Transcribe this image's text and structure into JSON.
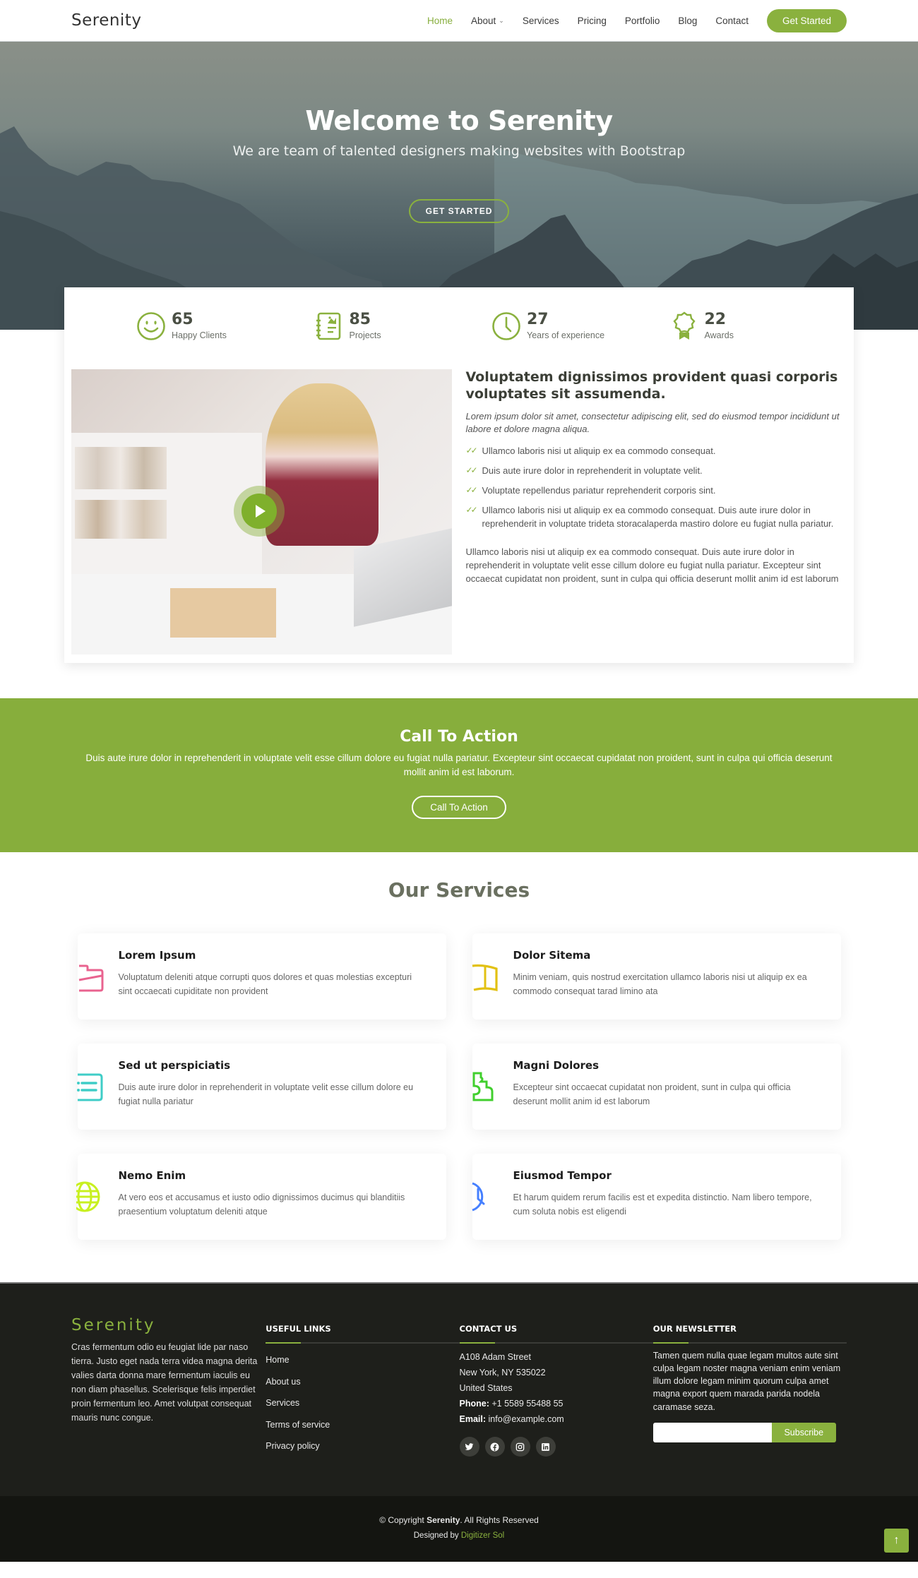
{
  "header": {
    "logo": "Serenity",
    "nav": [
      {
        "label": "Home",
        "active": true
      },
      {
        "label": "About",
        "dropdown": true
      },
      {
        "label": "Services"
      },
      {
        "label": "Pricing"
      },
      {
        "label": "Portfolio"
      },
      {
        "label": "Blog"
      },
      {
        "label": "Contact"
      }
    ],
    "cta_label": "Get Started"
  },
  "hero": {
    "title": "Welcome to Serenity",
    "subtitle": "We are team of talented designers making websites with Bootstrap",
    "button_label": "GET STARTED"
  },
  "stats": [
    {
      "icon": "smiley-icon",
      "value": "65",
      "label": "Happy Clients"
    },
    {
      "icon": "journal-richtext-icon",
      "value": "85",
      "label": "Projects"
    },
    {
      "icon": "clock-icon",
      "value": "27",
      "label": "Years of experience"
    },
    {
      "icon": "award-icon",
      "value": "22",
      "label": "Awards"
    }
  ],
  "about": {
    "title": "Voluptatem dignissimos provident quasi corporis voluptates sit assumenda.",
    "lead": "Lorem ipsum dolor sit amet, consectetur adipiscing elit, sed do eiusmod tempor incididunt ut labore et dolore magna aliqua.",
    "checklist": [
      "Ullamco laboris nisi ut aliquip ex ea commodo consequat.",
      "Duis aute irure dolor in reprehenderit in voluptate velit.",
      "Voluptate repellendus pariatur reprehenderit corporis sint.",
      "Ullamco laboris nisi ut aliquip ex ea commodo consequat. Duis aute irure dolor in reprehenderit in voluptate trideta storacalaperda mastiro dolore eu fugiat nulla pariatur."
    ],
    "body": "Ullamco laboris nisi ut aliquip ex ea commodo consequat. Duis aute irure dolor in reprehenderit in voluptate velit esse cillum dolore eu fugiat nulla pariatur. Excepteur sint occaecat cupidatat non proident, sunt in culpa qui officia deserunt mollit anim id est laborum"
  },
  "cta": {
    "title": "Call To Action",
    "text": "Duis aute irure dolor in reprehenderit in voluptate velit esse cillum dolore eu fugiat nulla pariatur. Excepteur sint occaecat cupidatat non proident, sunt in culpa qui officia deserunt mollit anim id est laborum.",
    "button_label": "Call To Action"
  },
  "services": {
    "title": "Our Services",
    "items": [
      {
        "icon": "briefcase-icon",
        "color": "#e9638f",
        "title": "Lorem Ipsum",
        "text": "Voluptatum deleniti atque corrupti quos dolores et quas molestias excepturi sint occaecati cupiditate non provident"
      },
      {
        "icon": "book-icon",
        "color": "#e2c113",
        "title": "Dolor Sitema",
        "text": "Minim veniam, quis nostrud exercitation ullamco laboris nisi ut aliquip ex ea commodo consequat tarad limino ata"
      },
      {
        "icon": "card-list-icon",
        "color": "#3fcdc7",
        "title": "Sed ut perspiciatis",
        "text": "Duis aute irure dolor in reprehenderit in voluptate velit esse cillum dolore eu fugiat nulla pariatur"
      },
      {
        "icon": "puzzle-icon",
        "color": "#41cf2e",
        "title": "Magni Dolores",
        "text": "Excepteur sint occaecat cupidatat non proident, sunt in culpa qui officia deserunt mollit anim id est laborum"
      },
      {
        "icon": "globe-icon",
        "color": "#d6ff22",
        "title": "Nemo Enim",
        "text": "At vero eos et accusamus et iusto odio dignissimos ducimus qui blanditiis praesentium voluptatum deleniti atque"
      },
      {
        "icon": "clock-icon",
        "color": "#4680ff",
        "title": "Eiusmod Tempor",
        "text": "Et harum quidem rerum facilis est et expedita distinctio. Nam libero tempore, cum soluta nobis est eligendi"
      }
    ]
  },
  "footer": {
    "brand": "Serenity",
    "about": "Cras fermentum odio eu feugiat lide par naso tierra. Justo eget nada terra videa magna derita valies darta donna mare fermentum iaculis eu non diam phasellus. Scelerisque felis imperdiet proin fermentum leo. Amet volutpat consequat mauris nunc congue.",
    "links_title": "USEFUL LINKS",
    "links": [
      "Home",
      "About us",
      "Services",
      "Terms of service",
      "Privacy policy"
    ],
    "contact_title": "CONTACT US",
    "address": [
      "A108 Adam Street",
      "New York, NY 535022",
      "United States"
    ],
    "phone_label": "Phone:",
    "phone": "+1 5589 55488 55",
    "email_label": "Email:",
    "email": "info@example.com",
    "social": [
      "twitter-icon",
      "facebook-icon",
      "instagram-icon",
      "linkedin-icon"
    ],
    "newsletter_title": "OUR NEWSLETTER",
    "newsletter_text": "Tamen quem nulla quae legam multos aute sint culpa legam noster magna veniam enim veniam illum dolore legam minim quorum culpa amet magna export quem marada parida nodela caramase seza.",
    "newsletter_placeholder": "",
    "subscribe_label": "Subscribe",
    "copyright_prefix": "© Copyright ",
    "copyright_brand": "Serenity",
    "copyright_suffix": ". All Rights Reserved",
    "designed_by_prefix": "Designed by ",
    "designed_by": "Digitizer Sol"
  },
  "colors": {
    "accent": "#8ab13e",
    "footer_bg": "#1e1f1b",
    "footer_bottom_bg": "#141511"
  }
}
